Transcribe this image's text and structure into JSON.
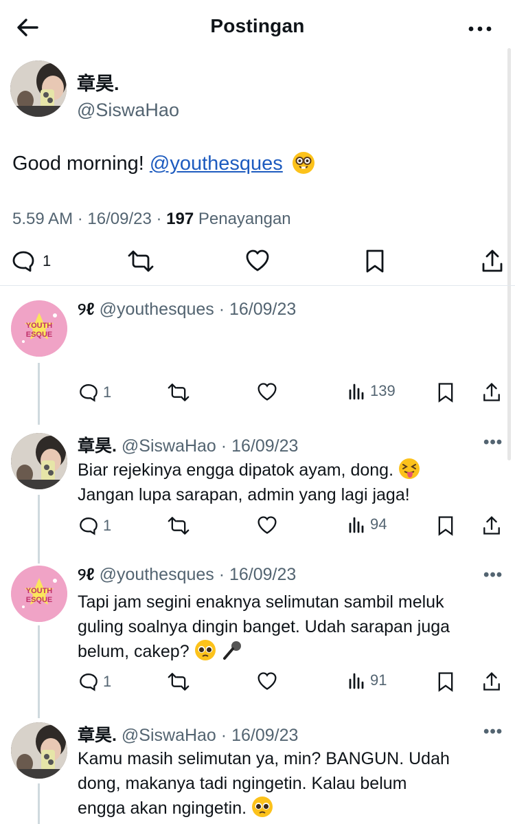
{
  "header": {
    "title": "Postingan"
  },
  "main_post": {
    "author_name": "章昊.",
    "author_handle": "@SiswaHao",
    "text": "Good morning! ",
    "mention": "@youthesques",
    "emoji": "nerd-face",
    "time": "5.59 AM",
    "date": "16/09/23",
    "views_count": "197",
    "views_label": "Penayangan",
    "reply_count": "1"
  },
  "replies": [
    {
      "name": "୨ℓ",
      "handle": "@youthesques",
      "date": "16/09/23",
      "text": "",
      "replies": "1",
      "views": "139",
      "avatar": "pink-logo"
    },
    {
      "name": "章昊.",
      "handle": "@SiswaHao",
      "date": "16/09/23",
      "text_line1": "Biar rejekinya engga dipatok ayam, dong. ",
      "text_line2": "Jangan lupa sarapan, admin yang lagi jaga!",
      "replies": "1",
      "views": "94",
      "avatar": "photo"
    },
    {
      "name": "୨ℓ",
      "handle": "@youthesques",
      "date": "16/09/23",
      "text_line1": "Tapi jam segini enaknya selimutan sambil meluk",
      "text_line2": "guling soalnya dingin banget. Udah sarapan juga",
      "text_line3": "belum, cakep? ",
      "replies": "1",
      "views": "91",
      "avatar": "pink-logo"
    },
    {
      "name": "章昊.",
      "handle": "@SiswaHao",
      "date": "16/09/23",
      "text_line1": "Kamu masih selimutan ya, min? BANGUN. Udah",
      "text_line2": "dong, makanya tadi ngingetin. Kalau belum",
      "text_line3": "engga akan ngingetin. ",
      "avatar": "photo"
    }
  ],
  "logo_text": {
    "line1": "YOUTH",
    "line2": "ESQUE"
  },
  "colors": {
    "accent_link": "#1d5bbf",
    "secondary_text": "#536471",
    "avatar_pink": "#f0a3c6"
  }
}
